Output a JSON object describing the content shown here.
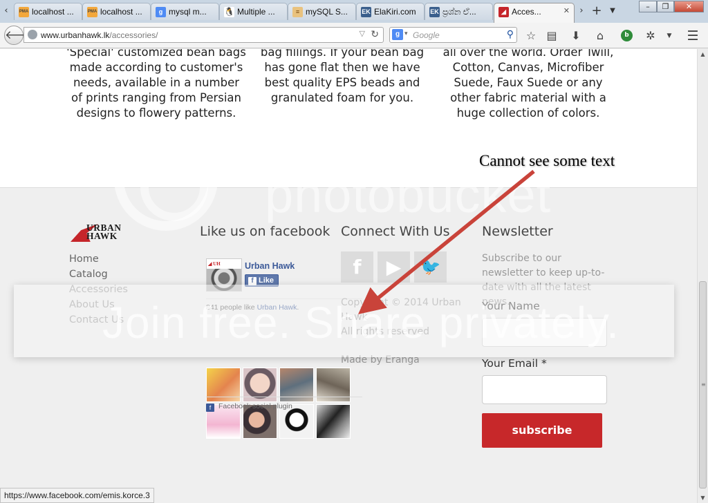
{
  "browser": {
    "tabs": [
      {
        "label": "localhost ...",
        "icon": "phpmyadmin-icon"
      },
      {
        "label": "localhost ...",
        "icon": "phpmyadmin-icon"
      },
      {
        "label": "mysql m...",
        "icon": "google-icon"
      },
      {
        "label": "Multiple ...",
        "icon": "linux-penguin-icon"
      },
      {
        "label": "mySQL S...",
        "icon": "document-icon"
      },
      {
        "label": "ElaKiri.com",
        "icon": "elakiri-icon"
      },
      {
        "label": "ප්‍රශ්න ඒ...",
        "icon": "elakiri-icon"
      },
      {
        "label": "Acces...",
        "icon": "urbanhawk-icon",
        "active": true
      }
    ],
    "url_domain": "www.urbanhawk.lk",
    "url_path": "/accessories/",
    "search_placeholder": "Google",
    "status_url": "https://www.facebook.com/emis.korce.3"
  },
  "page": {
    "features": [
      "'Special' customized bean bags made according to customer's needs, available in a number of prints ranging from Persian designs to flowery patterns.",
      "bag fillings. If your bean bag has gone flat then we have best quality EPS beads and granulated foam for you.",
      "all over the world. Order Twill, Cotton, Canvas, Microfiber Suede, Faux Suede or any other fabric material with a huge collection of colors."
    ],
    "logo": {
      "line1": "URBAN",
      "line2": "HAWK"
    },
    "footer_links": [
      "Home",
      "Catalog",
      "Accessories",
      "About Us",
      "Contact Us"
    ],
    "facebook": {
      "heading": "Like us on facebook",
      "page_name": "Urban Hawk",
      "like_label": "Like",
      "count_text": "841 people like ",
      "count_link": "Urban Hawk",
      "count_end": ".",
      "plugin_label": "Facebook social plugin"
    },
    "connect": {
      "heading": "Connect With Us",
      "copyright_line1": "Copyright © 2014 Urban",
      "copyright_line2": "Hawk",
      "rights": "All rights reserved",
      "made_by": "Made by Eranga"
    },
    "newsletter": {
      "heading": "Newsletter",
      "description": "Subscribe to our newsletter to keep up-to-date with all the latest news.",
      "name_label": "Your Name",
      "email_label": "Your Email *",
      "subscribe_label": "subscribe"
    }
  },
  "overlay": {
    "annotation": "Cannot see some text",
    "watermark": "photobucket",
    "band_text": "Join free. Share privately."
  }
}
